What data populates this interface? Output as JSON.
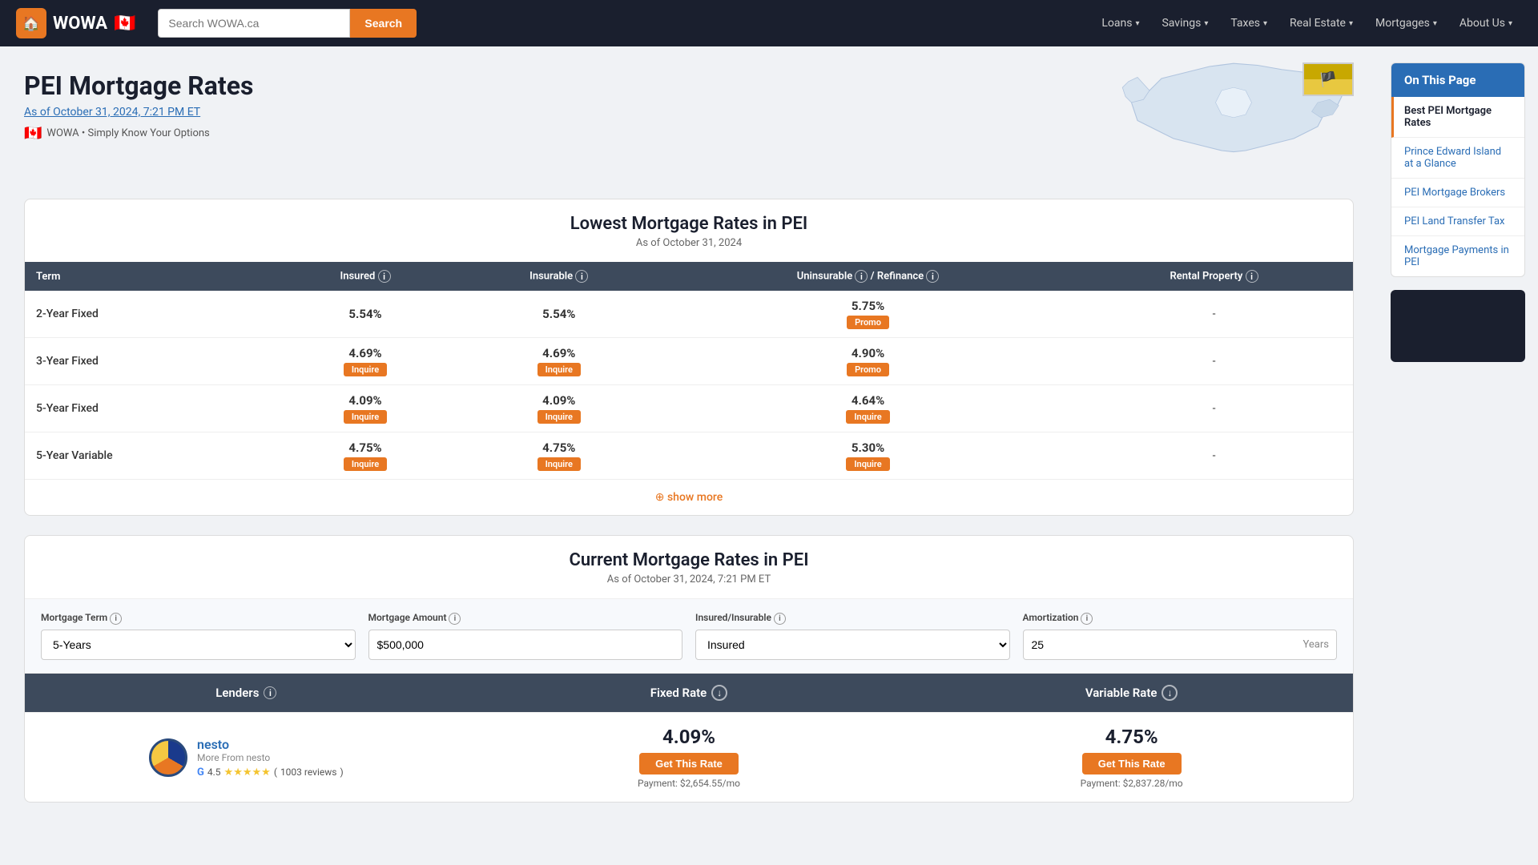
{
  "nav": {
    "logo_text": "WOWA",
    "logo_icon": "🏠",
    "search_placeholder": "Search WOWA.ca",
    "search_button": "Search",
    "links": [
      {
        "label": "Loans",
        "has_dropdown": true
      },
      {
        "label": "Savings",
        "has_dropdown": true
      },
      {
        "label": "Taxes",
        "has_dropdown": true
      },
      {
        "label": "Real Estate",
        "has_dropdown": true
      },
      {
        "label": "Mortgages",
        "has_dropdown": true
      },
      {
        "label": "About Us",
        "has_dropdown": true
      }
    ]
  },
  "hero": {
    "title": "PEI Mortgage Rates",
    "date": "As of October 31, 2024, 7:21 PM ET",
    "tagline": "WOWA • Simply Know Your Options"
  },
  "lowest_rates": {
    "title": "Lowest Mortgage Rates in PEI",
    "subtitle": "As of October 31, 2024",
    "columns": [
      "Term",
      "Insured",
      "Insurable",
      "Uninsurable / Refinance",
      "Rental Property"
    ],
    "rows": [
      {
        "term": "2-Year Fixed",
        "insured": "5.54%",
        "insured_badge": null,
        "insurable": "5.54%",
        "insurable_badge": null,
        "uninsurable": "5.75%",
        "uninsurable_badge": "Promo",
        "rental": "-"
      },
      {
        "term": "3-Year Fixed",
        "insured": "4.69%",
        "insured_badge": "Inquire",
        "insurable": "4.69%",
        "insurable_badge": "Inquire",
        "uninsurable": "4.90%",
        "uninsurable_badge": "Promo",
        "rental": "-"
      },
      {
        "term": "5-Year Fixed",
        "insured": "4.09%",
        "insured_badge": "Inquire",
        "insurable": "4.09%",
        "insurable_badge": "Inquire",
        "uninsurable": "4.64%",
        "uninsurable_badge": "Inquire",
        "rental": "-"
      },
      {
        "term": "5-Year Variable",
        "insured": "4.75%",
        "insured_badge": "Inquire",
        "insurable": "4.75%",
        "insurable_badge": "Inquire",
        "uninsurable": "5.30%",
        "uninsurable_badge": "Inquire",
        "rental": "-"
      }
    ],
    "show_more": "show more"
  },
  "current_rates": {
    "title": "Current Mortgage Rates in PEI",
    "subtitle": "As of October 31, 2024, 7:21 PM ET",
    "filters": {
      "term_label": "Mortgage Term",
      "term_value": "5-Years",
      "amount_label": "Mortgage Amount",
      "amount_value": "$500,000",
      "insured_label": "Insured/Insurable",
      "insured_value": "Insured",
      "amort_label": "Amortization",
      "amort_value": "25",
      "amort_unit": "Years"
    },
    "table_headers": {
      "lenders": "Lenders",
      "fixed_rate": "Fixed Rate",
      "variable_rate": "Variable Rate"
    },
    "lenders": [
      {
        "name": "nesto",
        "more_from": "More From nesto",
        "rating": "4.5",
        "review_count": "1003 reviews",
        "fixed_rate": "4.09%",
        "fixed_btn": "Get This Rate",
        "fixed_payment": "Payment: $2,654.55/mo",
        "variable_rate": "4.75%",
        "variable_btn": "Get This Rate",
        "variable_payment": "Payment: $2,837.28/mo"
      }
    ]
  },
  "toc": {
    "header": "On This Page",
    "items": [
      {
        "label": "Best PEI Mortgage Rates",
        "active": true
      },
      {
        "label": "Prince Edward Island at a Glance",
        "active": false
      },
      {
        "label": "PEI Mortgage Brokers",
        "active": false
      },
      {
        "label": "PEI Land Transfer Tax",
        "active": false
      },
      {
        "label": "Mortgage Payments in PEI",
        "active": false
      }
    ]
  }
}
